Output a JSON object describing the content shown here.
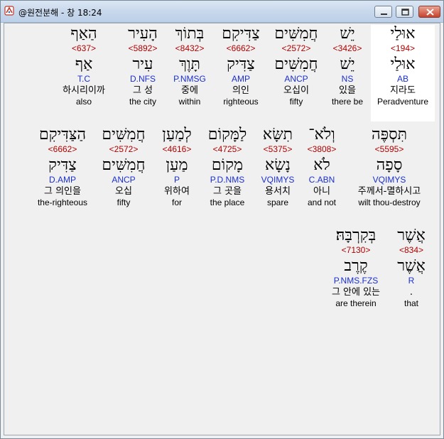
{
  "window": {
    "title": "@원전분해 - 창 18:24"
  },
  "rows": [
    {
      "words": [
        {
          "hebrew": "אוּלַי",
          "strong": "<194>",
          "lemma": "אוּלַי",
          "parse": "AB",
          "korean": "지라도",
          "english": "Peradventure",
          "highlight": true
        },
        {
          "hebrew": "יֵשׁ",
          "strong": "<3426>",
          "lemma": "יֵשׁ",
          "parse": "NS",
          "korean": "있을",
          "english": "there be",
          "highlight": false
        },
        {
          "hebrew": "חֲמִשִּׁים",
          "strong": "<2572>",
          "lemma": "חֲמִשִּׁים",
          "parse": "ANCP",
          "korean": "오십이",
          "english": "fifty",
          "highlight": false
        },
        {
          "hebrew": "צַדִּיקִם",
          "strong": "<6662>",
          "lemma": "צַדִּיק",
          "parse": "AMP",
          "korean": "의인",
          "english": "righteous",
          "highlight": false
        },
        {
          "hebrew": "בְּתוֹךְ",
          "strong": "<8432>",
          "lemma": "תָּוֶךְ",
          "parse": "P.NMSG",
          "korean": "중에",
          "english": "within",
          "highlight": false
        },
        {
          "hebrew": "הָעִיר",
          "strong": "<5892>",
          "lemma": "עִיר",
          "parse": "D.NFS",
          "korean": "그 성",
          "english": "the city",
          "highlight": false
        },
        {
          "hebrew": "הַאַף",
          "strong": "<637>",
          "lemma": "אַף",
          "parse": "T.C",
          "korean": "하시리이까",
          "english": "also",
          "highlight": false
        }
      ]
    },
    {
      "words": [
        {
          "hebrew": "תִּסְפֶּה",
          "strong": "<5595>",
          "lemma": "סָפָה",
          "parse": "VQIMYS",
          "korean": "주께서-멸하시고",
          "english": "wilt thou-destroy",
          "highlight": false
        },
        {
          "hebrew": "וְלֹא־",
          "strong": "<3808>",
          "lemma": "לֹא",
          "parse": "C.ABN",
          "korean": "아니",
          "english": "and not",
          "highlight": false
        },
        {
          "hebrew": "תִשָּׂא",
          "strong": "<5375>",
          "lemma": "נָשָׂא",
          "parse": "VQIMYS",
          "korean": "용서치",
          "english": "spare",
          "highlight": false
        },
        {
          "hebrew": "לַמָּקוֹם",
          "strong": "<4725>",
          "lemma": "מָקוֹם",
          "parse": "P.D.NMS",
          "korean": "그 곳을",
          "english": "the place",
          "highlight": false
        },
        {
          "hebrew": "לְמַעַן",
          "strong": "<4616>",
          "lemma": "מַעַן",
          "parse": "P",
          "korean": "위하여",
          "english": "for",
          "highlight": false
        },
        {
          "hebrew": "חֲמִשִּׁים",
          "strong": "<2572>",
          "lemma": "חֲמִשִּׁים",
          "parse": "ANCP",
          "korean": "오십",
          "english": "fifty",
          "highlight": false
        },
        {
          "hebrew": "הַצַּדִּיקִם",
          "strong": "<6662>",
          "lemma": "צַדִּיק",
          "parse": "D.AMP",
          "korean": "그 의인을",
          "english": "the-righteous",
          "highlight": false
        }
      ]
    },
    {
      "words": [
        {
          "hebrew": "אֲשֶׁר",
          "strong": "<834>",
          "lemma": "אֲשֶׁר",
          "parse": "R",
          "korean": ".",
          "english": "that",
          "highlight": false
        },
        {
          "hebrew": "בְּקִרְבָּהּ׃",
          "strong": "<7130>",
          "lemma": "קֶרֶב",
          "parse": "P.NMS.FZS",
          "korean": "그 안에 있는",
          "english": "are therein",
          "highlight": false
        }
      ]
    }
  ]
}
